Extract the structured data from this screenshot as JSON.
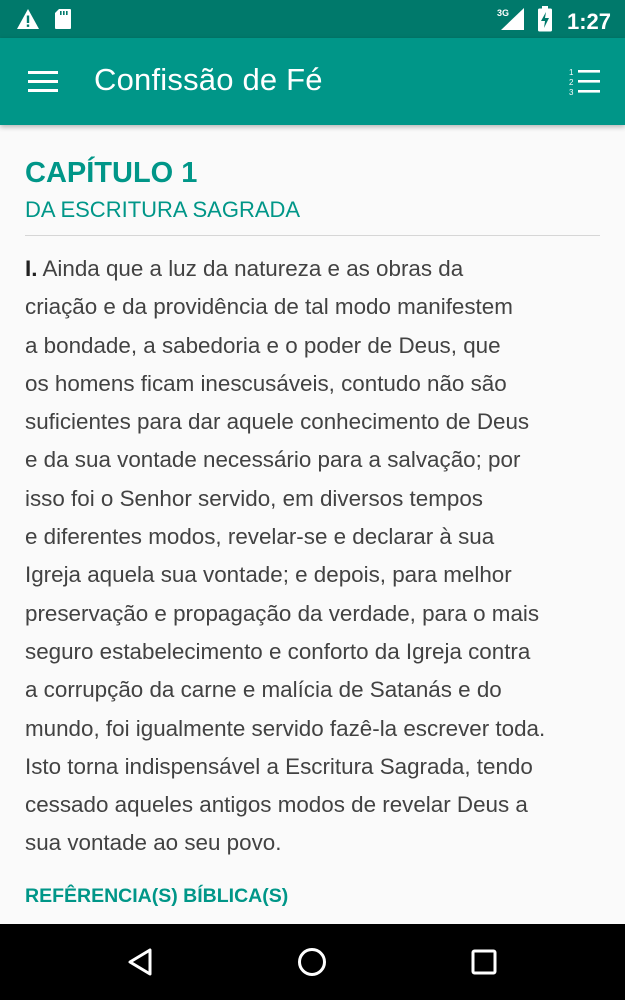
{
  "status_bar": {
    "time": "1:27",
    "network": "3G",
    "icons": [
      "warning-icon",
      "sd-card-icon",
      "signal-icon",
      "battery-charging-icon"
    ]
  },
  "app_bar": {
    "title": "Confissão de Fé",
    "menu_icon": "hamburger-menu-icon",
    "toc_icon": "numbered-list-icon"
  },
  "chapter": {
    "title": "CAPÍTULO 1",
    "subtitle": "DA ESCRITURA SAGRADA",
    "paragraph_numeral": "I.",
    "lines": [
      "Ainda que a luz da natureza e as obras da",
      "criação e da providência de tal modo manifestem",
      "a bondade, a sabedoria e o poder de Deus, que",
      "os homens ficam inescusáveis, contudo não são",
      "suficientes para dar aquele conhecimento de Deus",
      "e da sua vontade necessário para a salvação; por",
      "isso foi o Senhor servido, em diversos tempos",
      "e diferentes modos, revelar-se e declarar à sua",
      "Igreja aquela sua vontade; e depois, para melhor",
      "preservação e propagação da verdade, para o mais",
      "seguro estabelecimento e conforto da Igreja contra",
      "a corrupção da carne e malícia de Satanás e do",
      "mundo, foi igualmente servido fazê-la escrever toda.",
      "Isto torna indispensável a Escritura Sagrada, tendo",
      "cessado aqueles antigos modos de revelar Deus a",
      "sua vontade ao seu povo."
    ],
    "references_heading": "REFÊRENCIA(S) BÍBLICA(S)"
  },
  "nav_bar": {
    "buttons": [
      "back-icon",
      "home-icon",
      "recents-icon"
    ]
  },
  "colors": {
    "status_bar": "#00796b",
    "app_bar": "#009688",
    "accent": "#009688",
    "body_text": "#424242",
    "nav_bar": "#000000"
  }
}
